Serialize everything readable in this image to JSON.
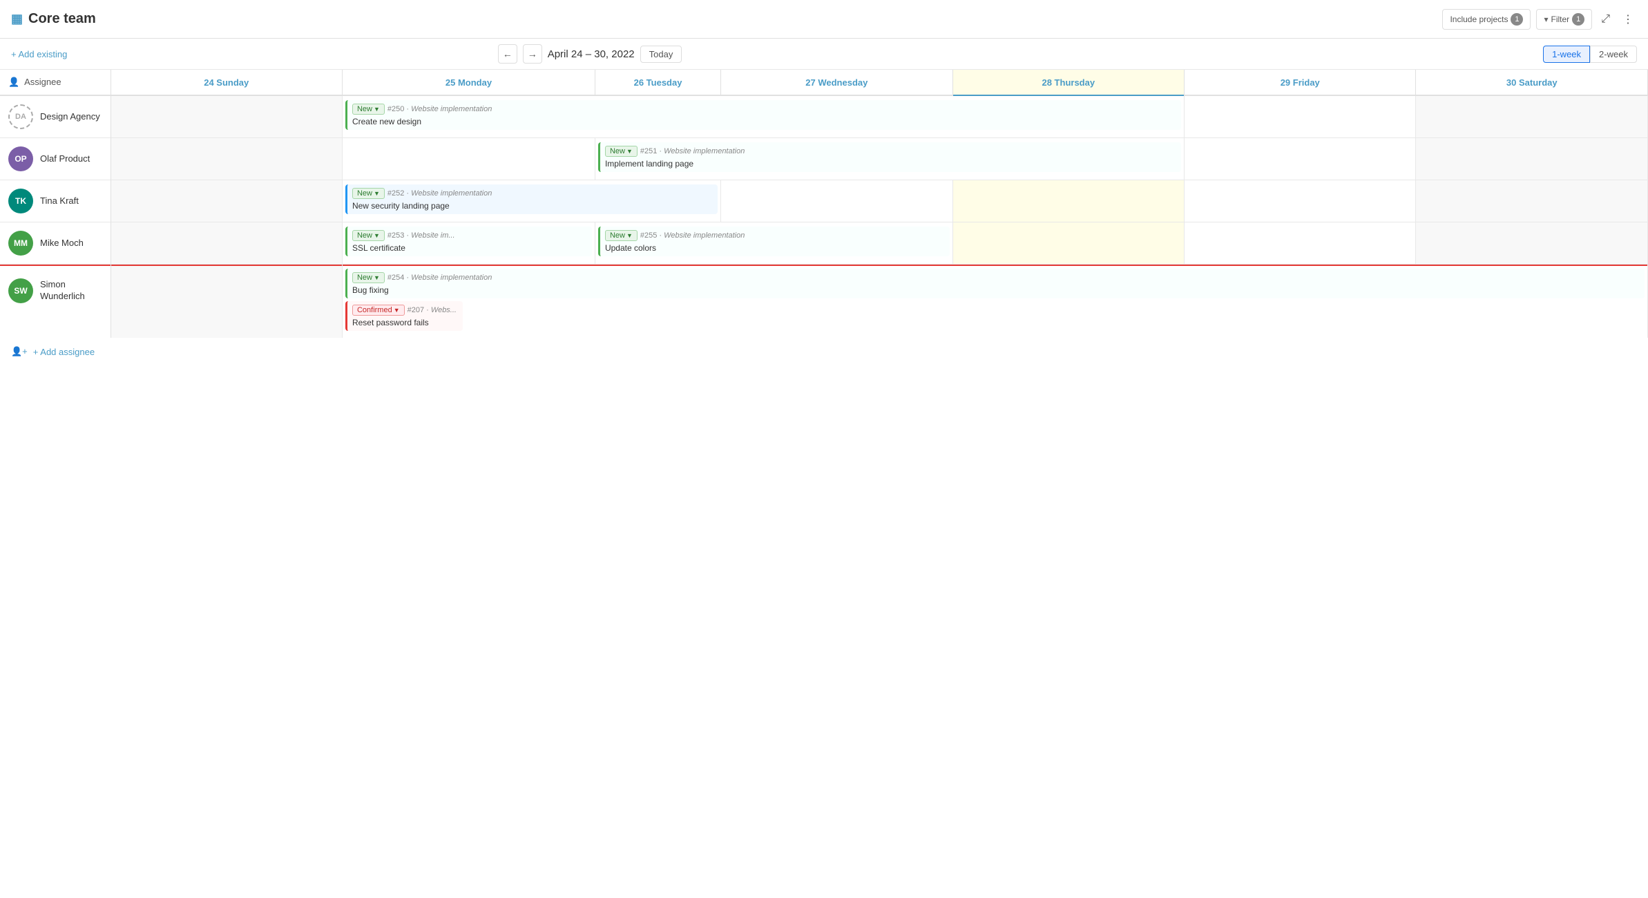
{
  "header": {
    "icon": "▦",
    "title": "Core team",
    "include_projects_label": "Include projects",
    "include_projects_count": "1",
    "filter_label": "Filter",
    "filter_count": "1",
    "expand_icon": "⤢",
    "more_icon": "⋮"
  },
  "toolbar": {
    "add_existing_label": "+ Add existing",
    "date_range": "April 24 – 30, 2022",
    "prev_label": "←",
    "next_label": "→",
    "today_label": "Today",
    "view_1week": "1-week",
    "view_2week": "2-week"
  },
  "columns": [
    {
      "id": "assignee",
      "label": "Assignee"
    },
    {
      "id": "sun24",
      "label": "24 Sunday",
      "day": 24,
      "today": false,
      "weekend": true
    },
    {
      "id": "mon25",
      "label": "25 Monday",
      "day": 25,
      "today": false,
      "weekend": false
    },
    {
      "id": "tue26",
      "label": "26 Tuesday",
      "day": 26,
      "today": false,
      "weekend": false
    },
    {
      "id": "wed27",
      "label": "27 Wednesday",
      "day": 27,
      "today": false,
      "weekend": false
    },
    {
      "id": "thu28",
      "label": "28 Thursday",
      "day": 28,
      "today": true,
      "weekend": false
    },
    {
      "id": "fri29",
      "label": "29 Friday",
      "day": 29,
      "today": false,
      "weekend": false
    },
    {
      "id": "sat30",
      "label": "30 Saturday",
      "day": 30,
      "today": false,
      "weekend": true
    }
  ],
  "assignees": [
    {
      "id": "da",
      "initials": "DA",
      "name": "Design Agency",
      "avatar_color": null,
      "avatar_dashed": true,
      "tasks": {
        "mon25": [
          {
            "id": "250",
            "status": "New",
            "status_type": "new",
            "project": "Website implementation",
            "title": "Create new design",
            "span": 4,
            "color": "green"
          }
        ]
      }
    },
    {
      "id": "op",
      "initials": "OP",
      "name": "Olaf Product",
      "avatar_color": "#7b5ea7",
      "avatar_dashed": false,
      "tasks": {
        "tue26": [
          {
            "id": "251",
            "status": "New",
            "status_type": "new",
            "project": "Website implementation",
            "title": "Implement landing page",
            "span": 3,
            "color": "green"
          }
        ]
      }
    },
    {
      "id": "tk",
      "initials": "TK",
      "name": "Tina Kraft",
      "avatar_color": "#00897b",
      "avatar_dashed": false,
      "tasks": {
        "mon25": [
          {
            "id": "252",
            "status": "New",
            "status_type": "new",
            "project": "Website implementation",
            "title": "New security landing page",
            "span": 2,
            "color": "blue"
          }
        ]
      }
    },
    {
      "id": "mm",
      "initials": "MM",
      "name": "Mike Moch",
      "avatar_color": "#43a047",
      "avatar_dashed": false,
      "tasks": {
        "mon25": [
          {
            "id": "253",
            "status": "New",
            "status_type": "new",
            "project": "Website im...",
            "title": "SSL certificate",
            "span": 1,
            "color": "green"
          }
        ],
        "tue26": [
          {
            "id": "255",
            "status": "New",
            "status_type": "new",
            "project": "Website implementation",
            "title": "Update colors",
            "span": 2,
            "color": "green"
          }
        ]
      }
    },
    {
      "id": "sw",
      "initials": "SW",
      "name": "Simon Wunderlich",
      "avatar_color": "#43a047",
      "avatar_dashed": false,
      "overdue": true,
      "tasks": {
        "mon25": [
          {
            "id": "254",
            "status": "New",
            "status_type": "new",
            "project": "Website implementation",
            "title": "Bug fixing",
            "span": 6,
            "color": "green"
          },
          {
            "id": "207",
            "status": "Confirmed",
            "status_type": "confirmed",
            "project": "Webs...",
            "title": "Reset password fails",
            "span": 1,
            "color": "red",
            "row_offset": 1
          }
        ]
      }
    }
  ],
  "add_assignee_label": "+ Add assignee",
  "colors": {
    "today_bg": "#fffde7",
    "today_border": "#4a9cc7",
    "weekend_bg": "#f8f8f8",
    "overdue_bar": "#e53935"
  }
}
